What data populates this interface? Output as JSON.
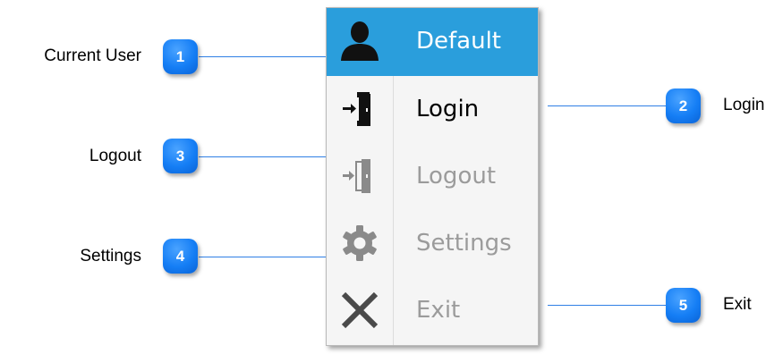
{
  "menu": {
    "items": [
      {
        "label": "Default",
        "icon": "user-icon",
        "state": "selected"
      },
      {
        "label": "Login",
        "icon": "login-door-icon",
        "state": "enabled"
      },
      {
        "label": "Logout",
        "icon": "logout-door-icon",
        "state": "disabled"
      },
      {
        "label": "Settings",
        "icon": "gear-icon",
        "state": "disabled"
      },
      {
        "label": "Exit",
        "icon": "close-x-icon",
        "state": "disabled"
      }
    ]
  },
  "callouts": [
    {
      "number": "1",
      "text": "Current User",
      "side": "left"
    },
    {
      "number": "2",
      "text": "Login",
      "side": "right"
    },
    {
      "number": "3",
      "text": "Logout",
      "side": "left"
    },
    {
      "number": "4",
      "text": "Settings",
      "side": "left"
    },
    {
      "number": "5",
      "text": "Exit",
      "side": "right"
    }
  ],
  "colors": {
    "selection": "#2a9edc",
    "badge": "#157ef5",
    "callout_line": "#2f7fe5",
    "disabled_text": "#9b9b9b",
    "icon_enabled": "#111111",
    "icon_disabled": "#8a8a8a"
  }
}
